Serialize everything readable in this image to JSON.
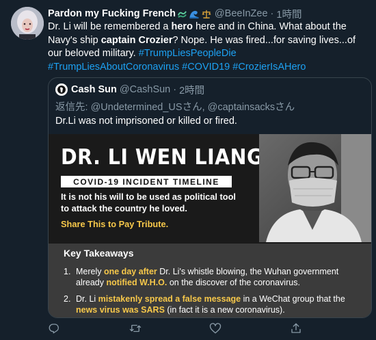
{
  "tweet": {
    "display_name": "Pardon my Fucking French",
    "emojis": [
      "wave-icon",
      "water-wave-icon",
      "scales-icon"
    ],
    "handle": "@BeeInZee",
    "dot": "·",
    "time": "1時間",
    "text": {
      "p1": "Dr. Li will be remembered a ",
      "b1": "hero",
      "p2": " here and in China. What about the Navy's ship ",
      "b2": "captain Crozier",
      "p3": "? Nope. He was fired...for saving lives...of our beloved military. ",
      "hashtags": [
        "#TrumpLiesPeopleDie",
        "#TrumpLiesAboutCoronavirus",
        "#COVID19",
        "#CrozierIsAHero"
      ]
    }
  },
  "quote": {
    "name": "Cash Sun",
    "handle": "@CashSun",
    "dot": "·",
    "time": "2時間",
    "reply_prefix": "返信先: ",
    "reply_mention1": "@Undetermined_USさん",
    "reply_sep": ", ",
    "reply_mention2": "@captainsacksさん",
    "text": "Dr.Li was not imprisoned or killed or fired."
  },
  "media": {
    "headline": "DR. LI WEN LIANG",
    "subtitle": "COVID-19 INCIDENT TIMELINE",
    "body_line1": "It is not his will to be used as political tool",
    "body_line2": "to attack the country he loved.",
    "share": "Share This to Pay Tribute.",
    "takeaways_title": "Key Takeaways",
    "item1": {
      "num": "1.",
      "a": "Merely ",
      "h1": "one day after",
      "b": " Dr. Li's whistle blowing, the Wuhan government already ",
      "h2": "notified W.H.O.",
      "c": " on the discover of the coronavirus."
    },
    "item2": {
      "num": "2.",
      "a": "Dr. Li ",
      "h1": "mistakenly spread a false message",
      "b": " in a WeChat group that the ",
      "h2": "news virus was SARS",
      "c": " (in fact it is a new coronavirus)."
    }
  },
  "actions": {
    "icons": [
      "reply-icon",
      "retweet-icon",
      "like-icon",
      "share-icon"
    ],
    "color": "#8899a6"
  },
  "colors": {
    "background": "#15202b",
    "link": "#1da1f2",
    "highlight": "#f7c84a",
    "muted": "#8899a6"
  }
}
